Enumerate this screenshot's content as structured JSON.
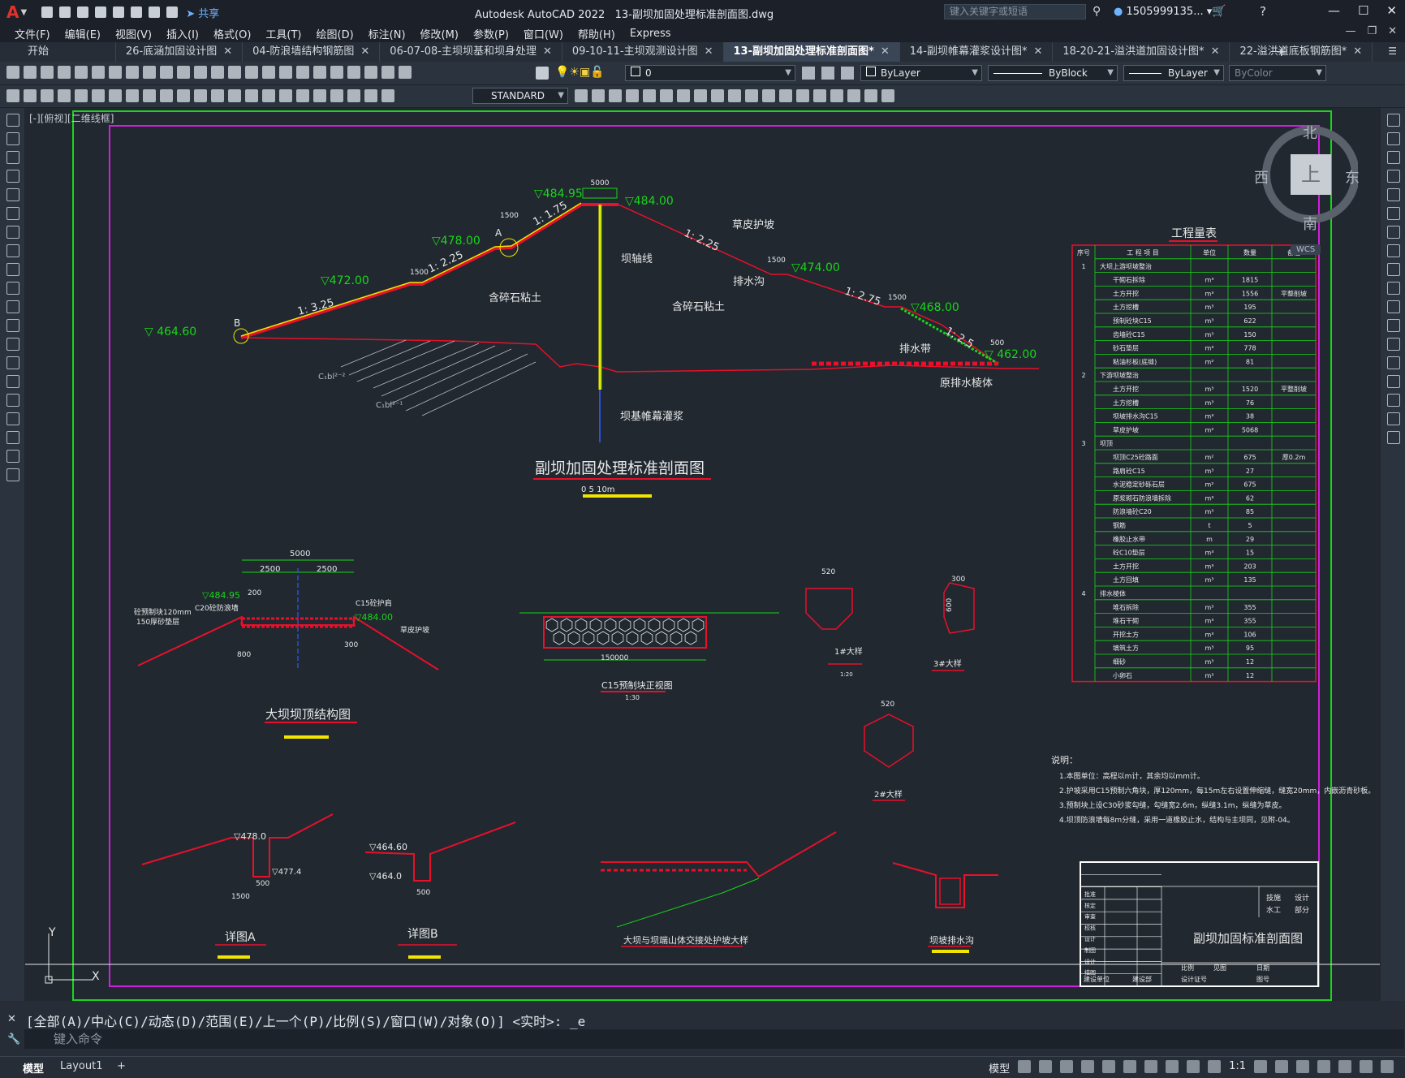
{
  "window": {
    "app_name": "Autodesk AutoCAD 2022",
    "file_name": "13-副坝加固处理标准剖面图.dwg",
    "search_placeholder": "键入关键字或短语",
    "user": "1505999135...",
    "share_label": "共享"
  },
  "menu": [
    "文件(F)",
    "编辑(E)",
    "视图(V)",
    "插入(I)",
    "格式(O)",
    "工具(T)",
    "绘图(D)",
    "标注(N)",
    "修改(M)",
    "参数(P)",
    "窗口(W)",
    "帮助(H)",
    "Express"
  ],
  "tabs": [
    {
      "label": "开始",
      "active": false,
      "closable": false
    },
    {
      "label": "26-底涵加固设计图",
      "active": false,
      "closable": true
    },
    {
      "label": "04-防浪墙结构钢筋图",
      "active": false,
      "closable": true
    },
    {
      "label": "06-07-08-主坝坝基和坝身处理",
      "active": false,
      "closable": true
    },
    {
      "label": "09-10-11-主坝观测设计图",
      "active": false,
      "closable": true
    },
    {
      "label": "13-副坝加固处理标准剖面图*",
      "active": true,
      "closable": true
    },
    {
      "label": "14-副坝帷幕灌浆设计图*",
      "active": false,
      "closable": true
    },
    {
      "label": "18-20-21-溢洪道加固设计图*",
      "active": false,
      "closable": true
    },
    {
      "label": "22-溢洪道底板钢筋图*",
      "active": false,
      "closable": true
    }
  ],
  "toolbar": {
    "layer_value": "0",
    "color_value": "ByLayer",
    "linetype_value": "ByBlock",
    "lineweight_value": "ByLayer",
    "plotstyle_value": "ByColor",
    "textstyle_value": "STANDARD"
  },
  "viewport_label": "[-][俯视][二维线框]",
  "viewcube": {
    "north": "北",
    "south": "南",
    "east": "东",
    "west": "西",
    "top": "上",
    "wcs": "WCS"
  },
  "drawing": {
    "main_title": "副坝加固处理标准剖面图",
    "scale_label": "0  5  10m",
    "crest_width": "5000",
    "labels": {
      "elev_48495": "▽484.95",
      "elev_48400": "▽484.00",
      "elev_47800": "▽478.00",
      "elev_47200": "▽472.00",
      "elev_47400": "▽474.00",
      "elev_46800": "▽468.00",
      "elev_46460": "▽ 464.60",
      "elev_46200": "▽ 462.00",
      "slope_175": "1: 1.75",
      "slope_225u": "1: 2.25",
      "slope_325": "1: 3.25",
      "slope_225d": "1: 2.25",
      "slope_275": "1: 2.75",
      "slope_25": "1: 2.5",
      "berm_1500": "1500",
      "toe_500": "500",
      "point_a": "A",
      "point_b": "B",
      "dam_axis": "坝轴线",
      "grass_slope": "草皮护坡",
      "drain_ditch": "排水沟",
      "soil_left": "含碎石粘土",
      "soil_right": "含碎石粘土",
      "drain_belt": "排水带",
      "toe_drain": "原排水棱体",
      "grout": "坝基帷幕灌浆",
      "cbl1": "C₁bl²⁻²",
      "cbl2": "C₁bl²⁻¹"
    },
    "sub_titles": {
      "crest": "大坝坝顶结构图",
      "c15": "C15预制块正视图",
      "c15_scale": "1:30",
      "big1": "1#大样",
      "big3": "3#大样",
      "big2": "2#大样",
      "scale_120": "1:20",
      "detail_a": "详图A",
      "detail_b": "详图B",
      "junction": "大坝与坝端山体交接处护坡大样",
      "ditch": "坝坡排水沟"
    },
    "crest_labels": {
      "w5000": "5000",
      "w2500a": "2500",
      "w2500b": "2500",
      "e48495": "▽484.95",
      "e48400": "▽484.00",
      "c20": "C20砼防浪墙",
      "c15": "C15砼护肩",
      "precast": "砼预制块120mm",
      "sand": "150厚砂垫层",
      "grass": "草皮护坡",
      "d800": "800",
      "d300": "300",
      "d200": "200"
    },
    "detail_labels": {
      "a_478": "▽478.0",
      "a_4774": "▽477.4",
      "a_1500": "1500",
      "a_500": "500",
      "b_4646": "▽464.60",
      "b_4640": "▽464.0",
      "b_500": "500",
      "d520a": "520",
      "d520b": "520",
      "d300": "300",
      "d150": "150",
      "d600": "600",
      "c15_len": "150000"
    },
    "notes_title": "说明：",
    "notes": [
      "1.本图单位：高程以m计，其余均以mm计。",
      "2.护坡采用C15预制六角块，厚120mm，每15m左右设置伸缩缝，缝宽20mm，内嵌沥青砂板。",
      "3.预制块上设C30砂浆勾缝，勾缝宽2.6m，纵缝3.1m，纵缝为草皮。",
      "4.坝顶防浪墙每8m分缝，采用一道橡胶止水，结构与主坝同，见附-04。"
    ]
  },
  "quantity_table": {
    "title": "工程量表",
    "headers": [
      "序号",
      "工 程 项 目",
      "单位",
      "数量",
      "备注"
    ],
    "rows": [
      [
        "1",
        "大坝上游坝坡整治",
        "",
        "",
        ""
      ],
      [
        "",
        "干砌石拆除",
        "m³",
        "1815",
        ""
      ],
      [
        "",
        "土方开挖",
        "m³",
        "1556",
        "平整削坡"
      ],
      [
        "",
        "土方挖槽",
        "m³",
        "195",
        ""
      ],
      [
        "",
        "预制砼块C15",
        "m³",
        "622",
        ""
      ],
      [
        "",
        "齿墙砼C15",
        "m³",
        "150",
        ""
      ],
      [
        "",
        "砂石垫层",
        "m³",
        "778",
        ""
      ],
      [
        "",
        "粘油杉板(底缝)",
        "m²",
        "81",
        ""
      ],
      [
        "2",
        "下游坝坡整治",
        "",
        "",
        ""
      ],
      [
        "",
        "土方开挖",
        "m³",
        "1520",
        "平整削坡"
      ],
      [
        "",
        "土方挖槽",
        "m³",
        "76",
        ""
      ],
      [
        "",
        "坝坡排水沟C15",
        "m³",
        "38",
        ""
      ],
      [
        "",
        "草皮护坡",
        "m²",
        "5068",
        ""
      ],
      [
        "3",
        "坝顶",
        "",
        "",
        ""
      ],
      [
        "",
        "坝顶C25砼路面",
        "m²",
        "675",
        "厚0.2m"
      ],
      [
        "",
        "路肩砼C15",
        "m³",
        "27",
        ""
      ],
      [
        "",
        "水泥稳定砂砾石层",
        "m²",
        "675",
        ""
      ],
      [
        "",
        "原浆砌石防浪墙拆除",
        "m³",
        "62",
        ""
      ],
      [
        "",
        "防浪墙砼C20",
        "m³",
        "85",
        ""
      ],
      [
        "",
        "钢筋",
        "t",
        "5",
        ""
      ],
      [
        "",
        "橡胶止水带",
        "m",
        "29",
        ""
      ],
      [
        "",
        "砼C10垫层",
        "m³",
        "15",
        ""
      ],
      [
        "",
        "土方开挖",
        "m³",
        "203",
        ""
      ],
      [
        "",
        "土方回填",
        "m³",
        "135",
        ""
      ],
      [
        "4",
        "排水棱体",
        "",
        "",
        ""
      ],
      [
        "",
        "堆石拆除",
        "m³",
        "355",
        ""
      ],
      [
        "",
        "堆石干砌",
        "m³",
        "355",
        ""
      ],
      [
        "",
        "开挖土方",
        "m³",
        "106",
        ""
      ],
      [
        "",
        "填筑土方",
        "m³",
        "95",
        ""
      ],
      [
        "",
        "细砂",
        "m³",
        "12",
        ""
      ],
      [
        "",
        "小卵石",
        "m³",
        "12",
        ""
      ]
    ]
  },
  "title_block": {
    "drawing_name": "副坝加固标准剖面图",
    "stage1": "技施",
    "stage2": "设计",
    "dept1": "水工",
    "dept2": "部分",
    "roles": [
      "批准",
      "核定",
      "审查",
      "校核",
      "设计",
      "制图",
      "设计",
      "描图"
    ],
    "ratio_label": "比例",
    "ratio_value": "见图",
    "date_label": "日期",
    "dwgno_label": "图号",
    "unit_label": "建设单位",
    "unit_value": "建设部",
    "cert_label": "设计证号"
  },
  "command": {
    "history": "[全部(A)/中心(C)/动态(D)/范围(E)/上一个(P)/比例(S)/窗口(W)/对象(O)] <实时>: _e",
    "placeholder": "键入命令"
  },
  "status": {
    "tab_model": "模型",
    "tab_layout1": "Layout1",
    "model_label": "模型",
    "scale": "1:1"
  },
  "colors": {
    "dam_red": "#e8102a",
    "cad_green": "#19d619",
    "cad_yellow": "#f2e600",
    "magenta_frame": "#d11fe0",
    "annot_white": "#e8e8e8"
  }
}
